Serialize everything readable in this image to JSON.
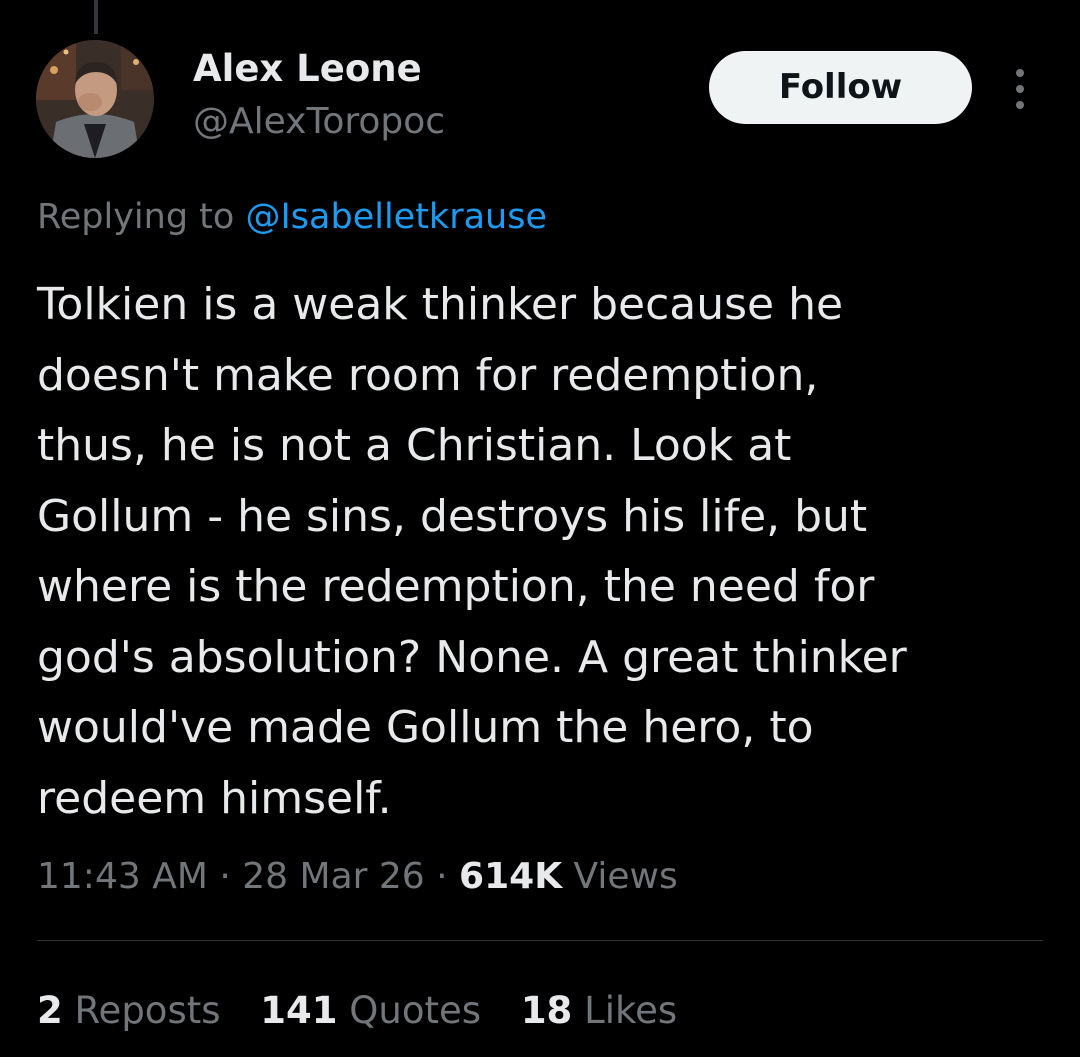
{
  "author": {
    "display_name": "Alex Leone",
    "handle": "@AlexToropoc",
    "avatar_icon": "profile-photo"
  },
  "follow_button": {
    "label": "Follow"
  },
  "more_menu": {
    "icon": "more-vertical-icon"
  },
  "reply_context": {
    "prefix": "Replying to",
    "mention": "@Isabelletkrause"
  },
  "tweet": {
    "text": "Tolkien is a weak thinker because he\ndoesn't make room for redemption,\nthus, he is not a Christian. Look at\nGollum - he sins, destroys his life, but\nwhere is the redemption, the need for\ngod's absolution? None. A great thinker\nwould've made Gollum the hero, to\nredeem himself."
  },
  "meta": {
    "time": "11:43 AM",
    "separator": "·",
    "date": "28 Mar 26",
    "views_count": "614K",
    "views_label": "Views"
  },
  "stats": {
    "reposts_count": "2",
    "reposts_label": "Reposts",
    "quotes_count": "141",
    "quotes_label": "Quotes",
    "likes_count": "18",
    "likes_label": "Likes"
  },
  "colors": {
    "background": "#000000",
    "primary_text": "#e7e9ea",
    "secondary_text": "#71767b",
    "link": "#1d9bf0",
    "divider": "#2f3336",
    "button_bg": "#eff3f4"
  }
}
